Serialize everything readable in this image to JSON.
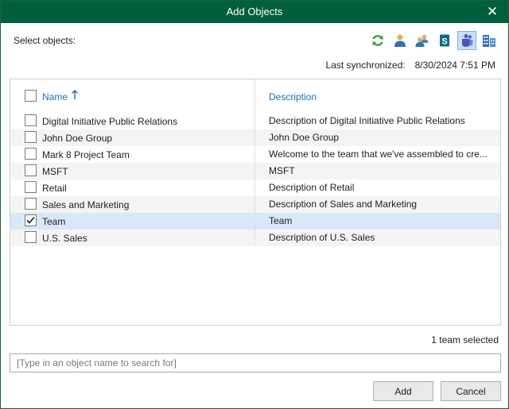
{
  "window": {
    "title": "Add Objects"
  },
  "labels": {
    "select_objects": "Select objects:",
    "last_sync_label": "Last synchronized:",
    "last_sync_value": "8/30/2024 7:51 PM"
  },
  "toolbar": {
    "buttons": [
      {
        "icon": "refresh-icon",
        "active": false
      },
      {
        "icon": "user-icon",
        "active": false
      },
      {
        "icon": "group-icon",
        "active": false
      },
      {
        "icon": "sharepoint-icon",
        "active": false
      },
      {
        "icon": "teams-icon",
        "active": true
      },
      {
        "icon": "organization-icon",
        "active": false
      }
    ]
  },
  "grid": {
    "columns": {
      "name": "Name",
      "description": "Description"
    },
    "sort": "ascending",
    "rows": [
      {
        "name": "Digital Initiative Public Relations",
        "description": "Description of Digital Initiative Public Relations",
        "checked": false
      },
      {
        "name": "John Doe Group",
        "description": "John Doe Group",
        "checked": false
      },
      {
        "name": "Mark 8 Project Team",
        "description": "Welcome to the team that we've assembled to cre...",
        "checked": false
      },
      {
        "name": "MSFT",
        "description": "MSFT",
        "checked": false
      },
      {
        "name": "Retail",
        "description": "Description of Retail",
        "checked": false
      },
      {
        "name": "Sales and Marketing",
        "description": "Description of Sales and Marketing",
        "checked": false
      },
      {
        "name": "Team",
        "description": "Team",
        "checked": true
      },
      {
        "name": "U.S. Sales",
        "description": "Description of U.S. Sales",
        "checked": false
      }
    ]
  },
  "status": "1 team selected",
  "search": {
    "placeholder": "[Type in an object name to search for]",
    "value": ""
  },
  "buttons": {
    "add": "Add",
    "cancel": "Cancel"
  },
  "colors": {
    "titlebar": "#005f3c",
    "header_link": "#1a6fb5",
    "selected_row": "#d9e8f8",
    "active_tool": "#c9e0f7"
  }
}
